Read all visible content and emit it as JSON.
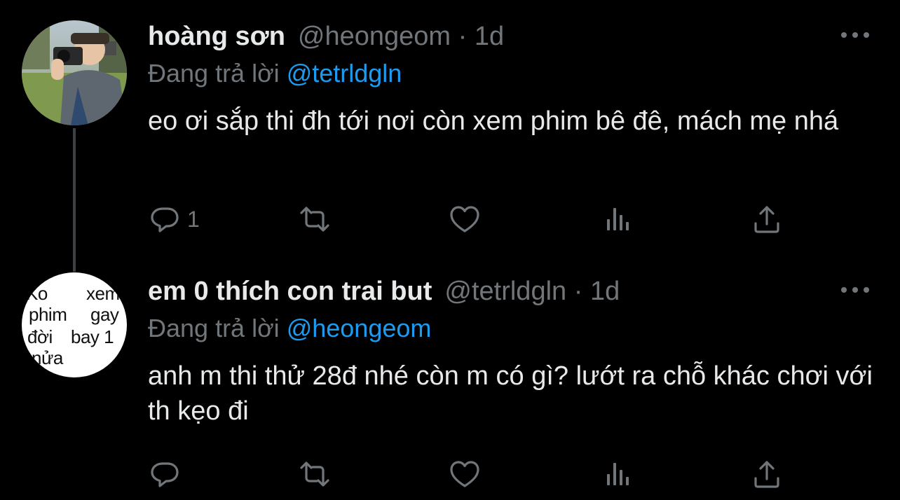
{
  "tweets": [
    {
      "display_name": "hoàng sơn",
      "handle": "@heongeom",
      "separator": "·",
      "time": "1d",
      "replying_label": "Đang trả lời",
      "replying_to": "@tetrldgln",
      "text": "eo ơi sắp thi đh tới nơi còn xem phim bê đê, mách mẹ nhá",
      "reply_count": "1",
      "avatar_icon": "photo-avatar"
    },
    {
      "display_name": "em 0 thích con trai but",
      "handle": "@tetrldgln",
      "separator": "·",
      "time": "1d",
      "replying_label": "Đang trả lời",
      "replying_to": "@heongeom",
      "text": "anh m thi thử 28đ nhé còn m có gì? lướt ra chỗ khác chơi với th kẹo đi",
      "reply_count": "",
      "avatar_text": [
        "Ko",
        "xem",
        "phim",
        "gay",
        "đời",
        "bay 1",
        "nửa"
      ]
    }
  ],
  "icons": {
    "reply": "speech-bubble-icon",
    "retweet": "retweet-icon",
    "like": "heart-icon",
    "views": "bar-chart-icon",
    "share": "share-upload-icon",
    "more": "ellipsis-icon"
  },
  "colors": {
    "background": "#000000",
    "primary_text": "#e7e9ea",
    "secondary_text": "#71767b",
    "accent": "#1d9bf0",
    "thread_line": "#3e4144"
  }
}
